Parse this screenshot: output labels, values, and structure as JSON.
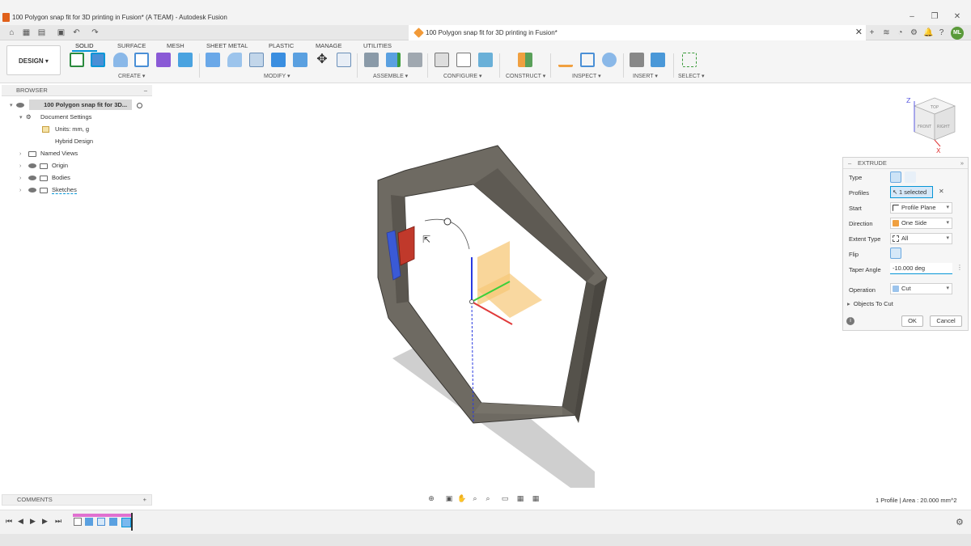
{
  "window": {
    "title": "100 Polygon snap fit for 3D printing in Fusion* (A TEAM) - Autodesk Fusion",
    "minimize": "–",
    "maximize": "❐",
    "close": "✕"
  },
  "doc_tab": {
    "title": "100 Polygon snap fit for 3D printing in Fusion*",
    "close": "✕"
  },
  "user": {
    "initials": "ML"
  },
  "toolbar": {
    "workspace": "DESIGN ▾",
    "tabs": [
      "SOLID",
      "SURFACE",
      "MESH",
      "SHEET METAL",
      "PLASTIC",
      "MANAGE",
      "UTILITIES"
    ],
    "active_tab": "SOLID",
    "groups": [
      "CREATE ▾",
      "MODIFY ▾",
      "ASSEMBLE ▾",
      "CONFIGURE ▾",
      "CONSTRUCT ▾",
      "INSPECT ▾",
      "INSERT ▾",
      "SELECT ▾"
    ]
  },
  "browser": {
    "header": "BROWSER",
    "collapse": "–",
    "root": "100 Polygon snap fit for 3D...",
    "items": [
      {
        "label": "Document Settings"
      },
      {
        "label": "Units: mm, g"
      },
      {
        "label": "Hybrid Design"
      },
      {
        "label": "Named Views"
      },
      {
        "label": "Origin"
      },
      {
        "label": "Bodies"
      },
      {
        "label": "Sketches"
      }
    ]
  },
  "extrude": {
    "header": "EXTRUDE",
    "labels": {
      "type": "Type",
      "profiles": "Profiles",
      "start": "Start",
      "direction": "Direction",
      "extent_type": "Extent Type",
      "flip": "Flip",
      "taper_angle": "Taper Angle",
      "operation": "Operation"
    },
    "profiles_value": "1 selected",
    "clear": "✕",
    "start_value": "Profile Plane",
    "direction_value": "One Side",
    "extent_value": "All",
    "taper_value": "-10.000 deg",
    "operation_value": "Cut",
    "objects_to_cut": "Objects To Cut",
    "ok": "OK",
    "cancel": "Cancel",
    "info": "i"
  },
  "viewcube": {
    "top": "TOP",
    "front": "FRONT",
    "right": "RIGHT",
    "z": "Z",
    "x": "X"
  },
  "comments": {
    "label": "COMMENTS",
    "add": "+"
  },
  "status": {
    "text": "1 Profile | Area : 20.000 mm^2"
  }
}
